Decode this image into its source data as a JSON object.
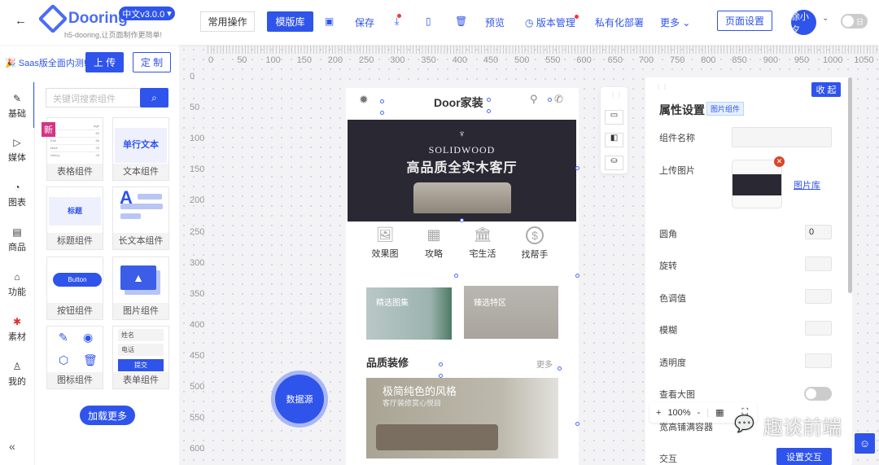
{
  "header": {
    "back": "←",
    "brand": "Dooring",
    "slogan": "h5-dooring,让页面制作更简单!",
    "lang": "中文v3.0.0",
    "common_ops": "常用操作",
    "template_lib": "模版库",
    "save": "保存",
    "preview": "预览",
    "version": "版本管理",
    "private_deploy": "私有化部署",
    "more": "更多",
    "page_settings": "页面设置",
    "user": "徐小夕",
    "theme_toggle": "日"
  },
  "promo": {
    "text": "🎉 Saas版全面内测!",
    "upload": "上 传",
    "custom": "定 制"
  },
  "nav": [
    {
      "label": "基础",
      "icon": "✎"
    },
    {
      "label": "媒体",
      "icon": "▷"
    },
    {
      "label": "图表",
      "icon": "◔"
    },
    {
      "label": "商品",
      "icon": "▤"
    },
    {
      "label": "功能",
      "icon": "⌂"
    },
    {
      "label": "素材",
      "icon": "✱"
    },
    {
      "label": "我的",
      "icon": "♙"
    }
  ],
  "collapse": "«",
  "search": {
    "placeholder": "关键词搜索组件"
  },
  "components": [
    {
      "label": "表格组件",
      "badge": "新"
    },
    {
      "label": "文本组件",
      "preview": "单行文本"
    },
    {
      "label": "标题组件",
      "preview": "标题"
    },
    {
      "label": "长文本组件",
      "preview": "A"
    },
    {
      "label": "按钮组件",
      "preview": "Button"
    },
    {
      "label": "图片组件"
    },
    {
      "label": "图标组件"
    },
    {
      "label": "表单组件",
      "fields": [
        "姓名",
        "电话",
        "提交"
      ]
    }
  ],
  "table_preview": {
    "head": [
      "",
      "Age"
    ],
    "rows": [
      [
        "",
        "60"
      ],
      [
        "Eair",
        "66"
      ],
      [
        "Mark",
        "25"
      ],
      [
        "Nancy",
        "25"
      ]
    ]
  },
  "load_more": "加载更多",
  "ruler": {
    "top": [
      "0",
      "50",
      "100",
      "150",
      "200",
      "250",
      "300",
      "350",
      "400",
      "450",
      "500",
      "550",
      "600",
      "650",
      "700",
      "750",
      "800",
      "850",
      "900",
      "950",
      "1000",
      "1050"
    ],
    "left": [
      "0",
      "50",
      "100",
      "150",
      "200",
      "250",
      "300",
      "350",
      "400",
      "450",
      "500",
      "550",
      "600"
    ]
  },
  "phone": {
    "title": "Door家装",
    "banner_en": "SOLIDWOOD",
    "banner_cn": "高品质全实木客厅",
    "icons": [
      {
        "label": "效果图",
        "icon": "🖼"
      },
      {
        "label": "攻略",
        "icon": "▦"
      },
      {
        "label": "宅生活",
        "icon": "🏛"
      },
      {
        "label": "找帮手",
        "icon": "$"
      }
    ],
    "tiles": [
      "精选图集",
      "臻选特区"
    ],
    "section": "品质装修",
    "more": "更多",
    "feature_title": "极简纯色的风格",
    "feature_sub": "客厅装修赏心悦目"
  },
  "datasource": "数据源",
  "zoom": {
    "plus": "+",
    "value": "100%",
    "minus": "-"
  },
  "panel": {
    "collapse": "收 起",
    "title": "属性设置",
    "tag": "图片组件",
    "fields": {
      "name": "组件名称",
      "upload": "上传图片",
      "gallery": "图片库",
      "radius": "圆角",
      "radius_value": "0",
      "rotate": "旋转",
      "hue": "色调值",
      "blur": "模糊",
      "opacity": "透明度",
      "view_large": "查看大图",
      "fill": "宽高铺满容器",
      "interact": "交互",
      "set_interact": "设置交互"
    }
  },
  "watermark": "趣谈前端",
  "colors": {
    "primary": "#2f54eb",
    "badge": "#d63384"
  }
}
